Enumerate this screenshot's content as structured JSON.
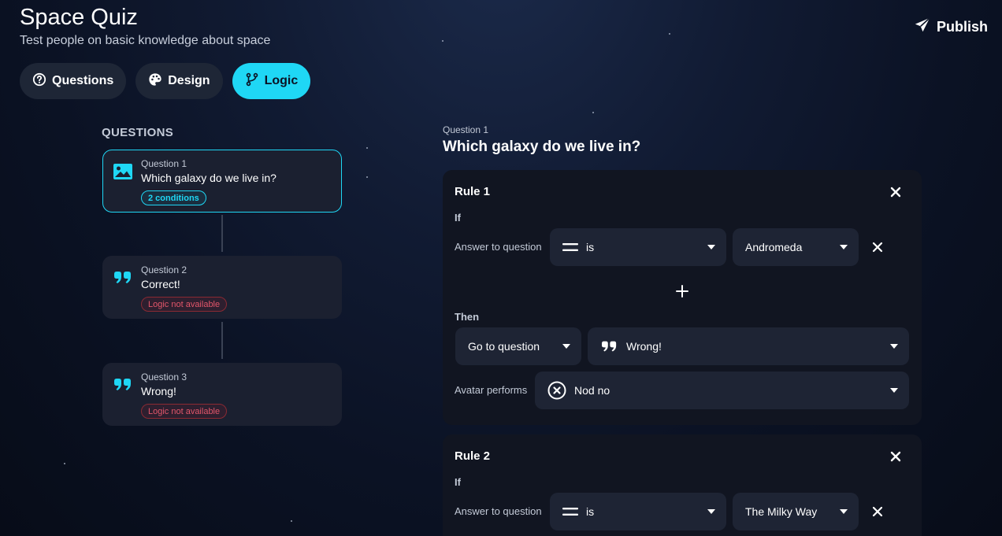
{
  "header": {
    "title": "Space Quiz",
    "subtitle": "Test people on basic knowledge about space",
    "publish_label": "Publish"
  },
  "tabs": [
    {
      "label": "Questions",
      "icon": "question-circle-icon",
      "active": false
    },
    {
      "label": "Design",
      "icon": "palette-icon",
      "active": false
    },
    {
      "label": "Logic",
      "icon": "branch-icon",
      "active": true
    }
  ],
  "sidebar": {
    "heading": "QUESTIONS",
    "questions": [
      {
        "number": "Question 1",
        "title": "Which galaxy do we live in?",
        "badge": "2 conditions",
        "badge_type": "cyan",
        "icon": "image-icon",
        "selected": true
      },
      {
        "number": "Question 2",
        "title": "Correct!",
        "badge": "Logic not available",
        "badge_type": "red",
        "icon": "quote-icon",
        "selected": false
      },
      {
        "number": "Question 3",
        "title": "Wrong!",
        "badge": "Logic not available",
        "badge_type": "red",
        "icon": "quote-icon",
        "selected": false
      }
    ]
  },
  "detail": {
    "question_number": "Question 1",
    "question_title": "Which galaxy do we live in?",
    "rules": [
      {
        "title": "Rule 1",
        "if_label": "If",
        "condition_label": "Answer to question",
        "operator": "is",
        "answer": "Andromeda",
        "then_label": "Then",
        "action": "Go to question",
        "target": "Wrong!",
        "avatar_label": "Avatar performs",
        "avatar_action": "Nod no"
      },
      {
        "title": "Rule 2",
        "if_label": "If",
        "condition_label": "Answer to question",
        "operator": "is",
        "answer": "The Milky Way"
      }
    ]
  },
  "colors": {
    "accent": "#1fd7f5",
    "card": "#1b2030",
    "rule_bg": "#111521",
    "select_bg": "#1e2434",
    "error": "#e2566a"
  }
}
